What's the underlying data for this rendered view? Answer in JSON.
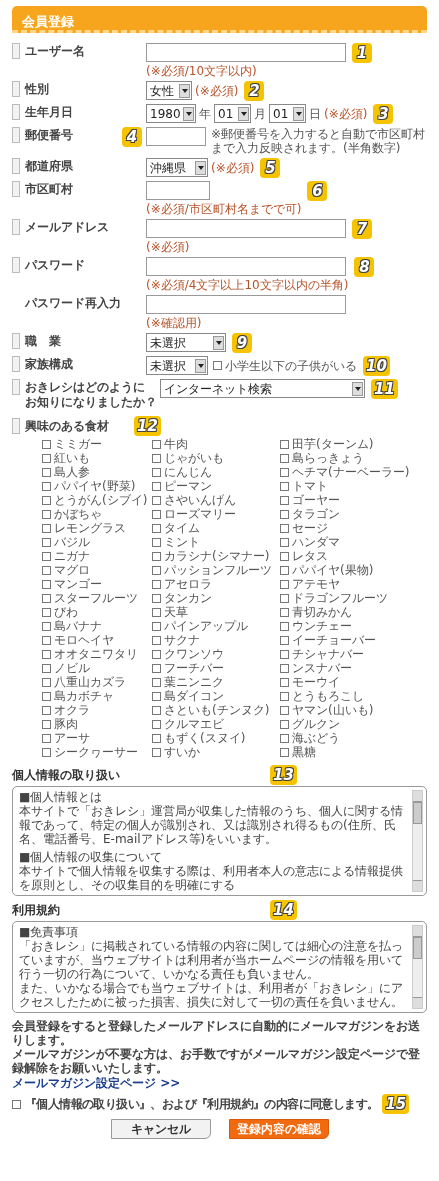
{
  "header": {
    "title": "会員登録"
  },
  "fields": [
    {
      "kind": "text",
      "marker": true,
      "label": "ユーザー名",
      "note": "(※必須/10文字以内)",
      "badge": "1"
    },
    {
      "kind": "select",
      "marker": true,
      "label": "性別",
      "value": "女性",
      "note": "(※必須)",
      "badge": "2"
    },
    {
      "kind": "date",
      "marker": true,
      "label": "生年月日",
      "parts": [
        {
          "value": "1980",
          "unit": "年"
        },
        {
          "value": "01",
          "unit": "月"
        },
        {
          "value": "01",
          "unit": "日"
        }
      ],
      "note": "(※必須)",
      "badge": "3"
    },
    {
      "kind": "postal",
      "marker": true,
      "label": "郵便番号",
      "badge": "4",
      "hint": "※郵便番号を入力すると自動で市区町村まで入力反映されます。(半角数字)"
    },
    {
      "kind": "select",
      "marker": true,
      "label": "都道府県",
      "value": "沖縄県",
      "note": "(※必須)",
      "badge": "5"
    },
    {
      "kind": "short",
      "marker": true,
      "label": "市区町村",
      "note": "(※必須/市区町村名までで可)",
      "badge": "6"
    },
    {
      "kind": "text",
      "marker": true,
      "label": "メールアドレス",
      "note": "(※必須)",
      "badge": "7"
    },
    {
      "kind": "text",
      "marker": true,
      "label": "パスワード",
      "note": "(※必須/4文字以上10文字以内の半角)",
      "badge": "8"
    },
    {
      "kind": "text",
      "marker": false,
      "label": "パスワード再入力",
      "note": "(※確認用)"
    },
    {
      "kind": "select",
      "marker": true,
      "label": "職　業",
      "value": "未選択",
      "badge": "9"
    },
    {
      "kind": "select-check",
      "marker": true,
      "label": "家族構成",
      "value": "未選択",
      "check": {
        "label": "小学生以下の子供がいる",
        "checked": false
      },
      "badge": "10"
    },
    {
      "kind": "select-wide",
      "marker": true,
      "label": [
        "おきレシはどのように",
        "お知りになりましたか？"
      ],
      "value": "インターネット検索",
      "badge": "11"
    }
  ],
  "interests": {
    "label": "興味のある食材",
    "badge": "12",
    "items": [
      {
        "label": "ミミガー",
        "checked": false
      },
      {
        "label": "牛肉",
        "checked": false
      },
      {
        "label": "田芋(ターンム)",
        "checked": false
      },
      {
        "label": "紅いも",
        "checked": false
      },
      {
        "label": "じゃがいも",
        "checked": false
      },
      {
        "label": "島らっきょう",
        "checked": false
      },
      {
        "label": "島人参",
        "checked": false
      },
      {
        "label": "にんじん",
        "checked": false
      },
      {
        "label": "ヘチマ(ナーベーラー)",
        "checked": false
      },
      {
        "label": "パパイヤ(野菜)",
        "checked": false
      },
      {
        "label": "ピーマン",
        "checked": false
      },
      {
        "label": "トマト",
        "checked": false
      },
      {
        "label": "とうがん(シブイ)",
        "checked": false
      },
      {
        "label": "さやいんげん",
        "checked": false
      },
      {
        "label": "ゴーヤー",
        "checked": false
      },
      {
        "label": "かぼちゃ",
        "checked": false
      },
      {
        "label": "ローズマリー",
        "checked": false
      },
      {
        "label": "タラゴン",
        "checked": false
      },
      {
        "label": "レモングラス",
        "checked": false
      },
      {
        "label": "タイム",
        "checked": false
      },
      {
        "label": "セージ",
        "checked": false
      },
      {
        "label": "バジル",
        "checked": false
      },
      {
        "label": "ミント",
        "checked": false
      },
      {
        "label": "ハンダマ",
        "checked": false
      },
      {
        "label": "ニガナ",
        "checked": false
      },
      {
        "label": "カラシナ(シマナー)",
        "checked": false
      },
      {
        "label": "レタス",
        "checked": false
      },
      {
        "label": "マグロ",
        "checked": false
      },
      {
        "label": "パッションフルーツ",
        "checked": false
      },
      {
        "label": "パパイヤ(果物)",
        "checked": false
      },
      {
        "label": "マンゴー",
        "checked": false
      },
      {
        "label": "アセロラ",
        "checked": false
      },
      {
        "label": "アテモヤ",
        "checked": false
      },
      {
        "label": "スターフルーツ",
        "checked": false
      },
      {
        "label": "タンカン",
        "checked": false
      },
      {
        "label": "ドラゴンフルーツ",
        "checked": false
      },
      {
        "label": "びわ",
        "checked": false
      },
      {
        "label": "天草",
        "checked": false
      },
      {
        "label": "青切みかん",
        "checked": false
      },
      {
        "label": "島バナナ",
        "checked": false
      },
      {
        "label": "パインアップル",
        "checked": false
      },
      {
        "label": "ウンチェー",
        "checked": false
      },
      {
        "label": "モロヘイヤ",
        "checked": false
      },
      {
        "label": "サクナ",
        "checked": false
      },
      {
        "label": "イーチョーバー",
        "checked": false
      },
      {
        "label": "オオタニワタリ",
        "checked": false
      },
      {
        "label": "クワンソウ",
        "checked": false
      },
      {
        "label": "チシャナバー",
        "checked": false
      },
      {
        "label": "ノビル",
        "checked": false
      },
      {
        "label": "フーチバー",
        "checked": false
      },
      {
        "label": "ンスナバー",
        "checked": false
      },
      {
        "label": "八重山カズラ",
        "checked": false
      },
      {
        "label": "葉ニンニク",
        "checked": false
      },
      {
        "label": "モーウイ",
        "checked": false
      },
      {
        "label": "島カボチャ",
        "checked": false
      },
      {
        "label": "島ダイコン",
        "checked": false
      },
      {
        "label": "とうもろこし",
        "checked": false
      },
      {
        "label": "オクラ",
        "checked": false
      },
      {
        "label": "さといも(チンヌク)",
        "checked": false
      },
      {
        "label": "ヤマン(山いも)",
        "checked": false
      },
      {
        "label": "豚肉",
        "checked": false
      },
      {
        "label": "クルマエビ",
        "checked": false
      },
      {
        "label": "グルクン",
        "checked": false
      },
      {
        "label": "アーサ",
        "checked": false
      },
      {
        "label": "もずく(スヌイ)",
        "checked": false
      },
      {
        "label": "海ぶどう",
        "checked": false
      },
      {
        "label": "シークヮーサー",
        "checked": false
      },
      {
        "label": "すいか",
        "checked": false
      },
      {
        "label": "黒糖",
        "checked": false
      }
    ]
  },
  "documents": [
    {
      "heading": "個人情報の取り扱い",
      "badge": "13",
      "paragraphs": [
        "■個人情報とは",
        "本サイトで「おきレシ」運営局が収集した情報のうち、個人に関する情報であって、特定の個人が識別され、又は識別され得るもの(住所、氏名、電話番号、E-mailアドレス等)をいいます。",
        "■個人情報の収集について",
        "本サイトで個人情報を収集する際は、利用者本人の意志による情報提供を原則とし、その収集目的を明確にする"
      ]
    },
    {
      "heading": "利用規約",
      "badge": "14",
      "paragraphs": [
        "■免責事項",
        "「おきレシ」に掲載されている情報の内容に関しては細心の注意を払っていますが、当ウェブサイトは利用者が当ホームページの情報を用いて行う一切の行為について、いかなる責任も負いません。",
        "また、いかなる場合でも当ウェブサイトは、利用者が「おきレシ」にアクセスしたために被った損害、損失に対して一切の責任を負いません。"
      ]
    }
  ],
  "notices": [
    "会員登録をすると登録したメールアドレスに自動的にメールマガジンをお送りします。",
    "メールマガジンが不要な方は、お手数ですがメールマガジン設定ページで登録解除をお願いいたします。"
  ],
  "link": "メールマガジン設定ページ >>",
  "agree": {
    "label": "『個人情報の取り扱い』、および『利用規約』の内容に同意します。",
    "checked": false,
    "badge": "15"
  },
  "buttons": [
    {
      "kind": "cancel",
      "label": "キャンセル"
    },
    {
      "kind": "submit",
      "label": "登録内容の確認"
    }
  ]
}
